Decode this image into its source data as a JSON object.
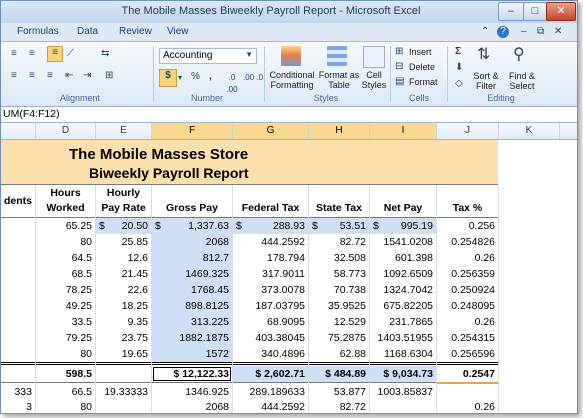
{
  "window": {
    "title": "The Mobile Masses Biweekly Payroll Report - Microsoft Excel"
  },
  "tabs": [
    "Formulas",
    "Data",
    "Review",
    "View"
  ],
  "ribbon": {
    "number_format": "Accounting",
    "groups": {
      "alignment": "Alignment",
      "number": "Number",
      "styles": "Styles",
      "cells": "Cells",
      "editing": "Editing"
    },
    "buttons": {
      "conditional_formatting": "Conditional Formatting",
      "format_as_table": "Format as Table",
      "cell_styles": "Cell Styles",
      "insert": "Insert",
      "delete": "Delete",
      "format": "Format",
      "sort_filter": "Sort & Filter",
      "find_select": "Find & Select"
    },
    "number_buttons": {
      "dollar": "$",
      "percent": "%",
      "comma": ",",
      "inc_decimal": ".0 .00",
      "dec_decimal": ".00 .0"
    }
  },
  "formula_bar": {
    "content": "UM(F4:F12)"
  },
  "columns": [
    "D",
    "E",
    "F",
    "G",
    "H",
    "I",
    "J",
    "K"
  ],
  "sheet_title": {
    "line1": "The Mobile Masses Store",
    "line2": "Biweekly Payroll Report"
  },
  "headers": {
    "c": "dents",
    "d1": "Hours",
    "d2": "Worked",
    "e1": "Hourly",
    "e2": "Pay Rate",
    "f": "Gross Pay",
    "g": "Federal Tax",
    "h": "State Tax",
    "i": "Net Pay",
    "j": "Tax %"
  },
  "rows": [
    {
      "d": "65.25",
      "e": "20.50",
      "f": "1,337.63",
      "g": "288.93",
      "h": "53.51",
      "i": "995.19",
      "j": "0.256"
    },
    {
      "d": "80",
      "e": "25.85",
      "f": "2068",
      "g": "444.2592",
      "h": "82.72",
      "i": "1541.0208",
      "j": "0.254826"
    },
    {
      "d": "64.5",
      "e": "12.6",
      "f": "812.7",
      "g": "178.794",
      "h": "32.508",
      "i": "601.398",
      "j": "0.26"
    },
    {
      "d": "68.5",
      "e": "21.45",
      "f": "1469.325",
      "g": "317.9011",
      "h": "58.773",
      "i": "1092.6509",
      "j": "0.256359"
    },
    {
      "d": "78.25",
      "e": "22.6",
      "f": "1768.45",
      "g": "373.0078",
      "h": "70.738",
      "i": "1324.7042",
      "j": "0.250924"
    },
    {
      "d": "49.25",
      "e": "18.25",
      "f": "898.8125",
      "g": "187.03795",
      "h": "35.9525",
      "i": "675.82205",
      "j": "0.248095"
    },
    {
      "d": "33.5",
      "e": "9.35",
      "f": "313.225",
      "g": "68.9095",
      "h": "12.529",
      "i": "231.7865",
      "j": "0.26"
    },
    {
      "d": "79.25",
      "e": "23.75",
      "f": "1882.1875",
      "g": "403.38045",
      "h": "75.2875",
      "i": "1403.51955",
      "j": "0.254315"
    },
    {
      "d": "80",
      "e": "19.65",
      "f": "1572",
      "g": "340.4896",
      "h": "62.88",
      "i": "1168.6304",
      "j": "0.256596"
    }
  ],
  "totals": {
    "d": "598.5",
    "f": "$ 12,122.33",
    "g": "$ 2,602.71",
    "h": "$ 484.89",
    "i": "$ 9,034.73",
    "j": "0.2547"
  },
  "extra_rows": [
    {
      "c": "333",
      "d": "66.5",
      "e": "19.33333",
      "f": "1346.925",
      "g": "289.189633",
      "h": "53.877",
      "i": "1003.85837"
    },
    {
      "c": "3",
      "d": "80",
      "e": "",
      "f": "2068",
      "g": "444.2592",
      "h": "82.72",
      "i": "",
      "j": "0.26"
    }
  ]
}
